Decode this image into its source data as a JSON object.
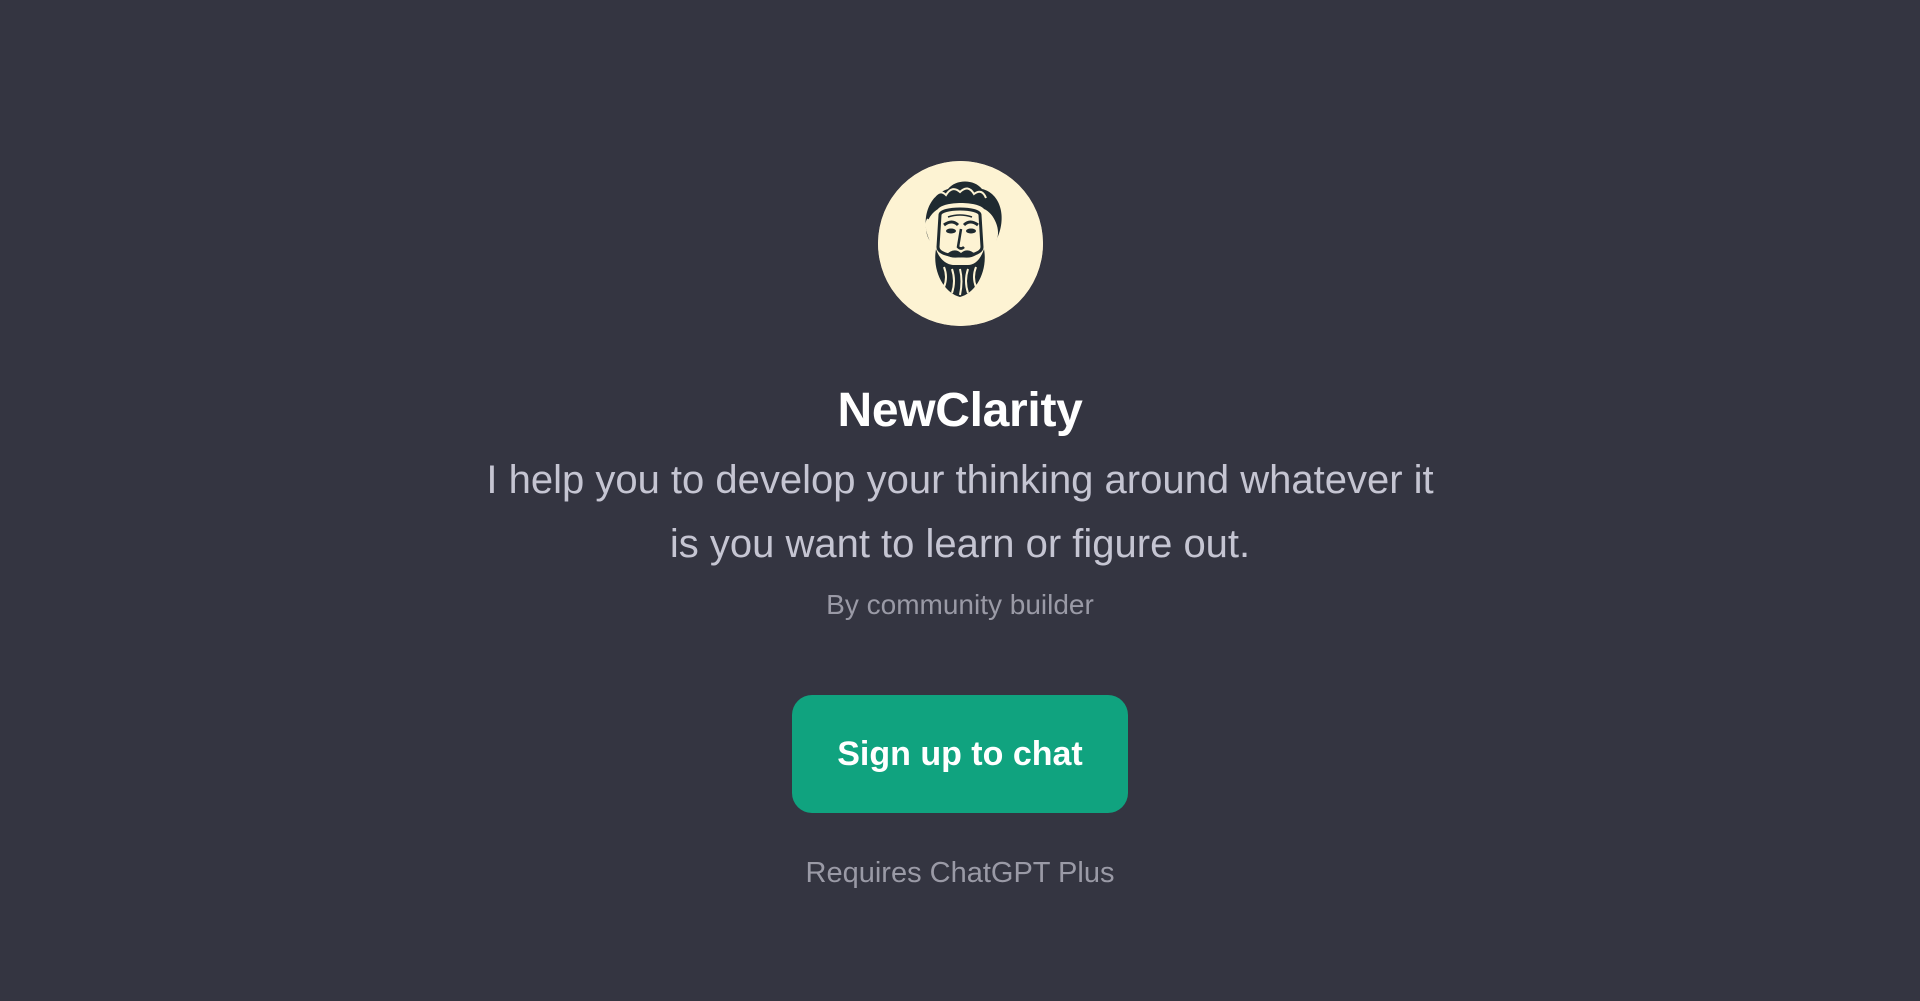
{
  "gpt": {
    "name": "NewClarity",
    "description": "I help you to develop your thinking around whatever it is you want to learn or figure out.",
    "byline": "By community builder",
    "avatar_icon": "philosopher-bust-icon"
  },
  "actions": {
    "signup_label": "Sign up to chat"
  },
  "footer": {
    "requirement": "Requires ChatGPT Plus"
  },
  "colors": {
    "background": "#343541",
    "accent": "#10a37f",
    "avatar_bg": "#fdf3d3",
    "title": "#ffffff",
    "description": "#c5c5d2",
    "muted": "#9a9aa6"
  }
}
